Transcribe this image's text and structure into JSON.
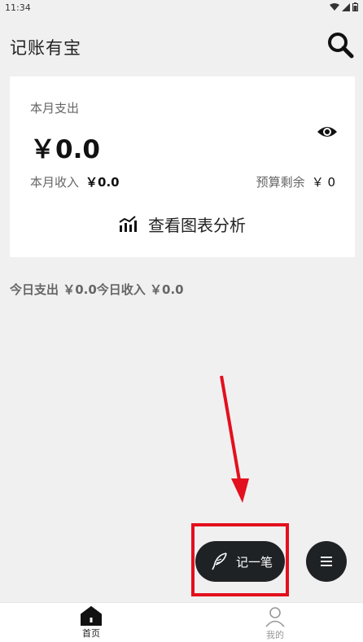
{
  "status_bar": {
    "time": "11:34"
  },
  "app_bar": {
    "title": "记账有宝",
    "search_icon": "search-icon"
  },
  "summary": {
    "month_expense_label": "本月支出",
    "month_expense_value": "￥0.0",
    "month_income_label": "本月收入",
    "month_income_value": "￥0.0",
    "budget_label": "预算剩余",
    "budget_value": "￥ 0",
    "chart_link_label": "查看图表分析"
  },
  "today": {
    "text": "今日支出 ￥0.0今日收入 ￥0.0"
  },
  "fab": {
    "record_label": "记一笔"
  },
  "bottom_nav": {
    "items": [
      {
        "label": "首页",
        "active": true
      },
      {
        "label": "我的",
        "active": false
      }
    ]
  },
  "colors": {
    "fab_bg": "#1f2225",
    "annotation": "#e3101d",
    "background": "#f1f0f1"
  }
}
